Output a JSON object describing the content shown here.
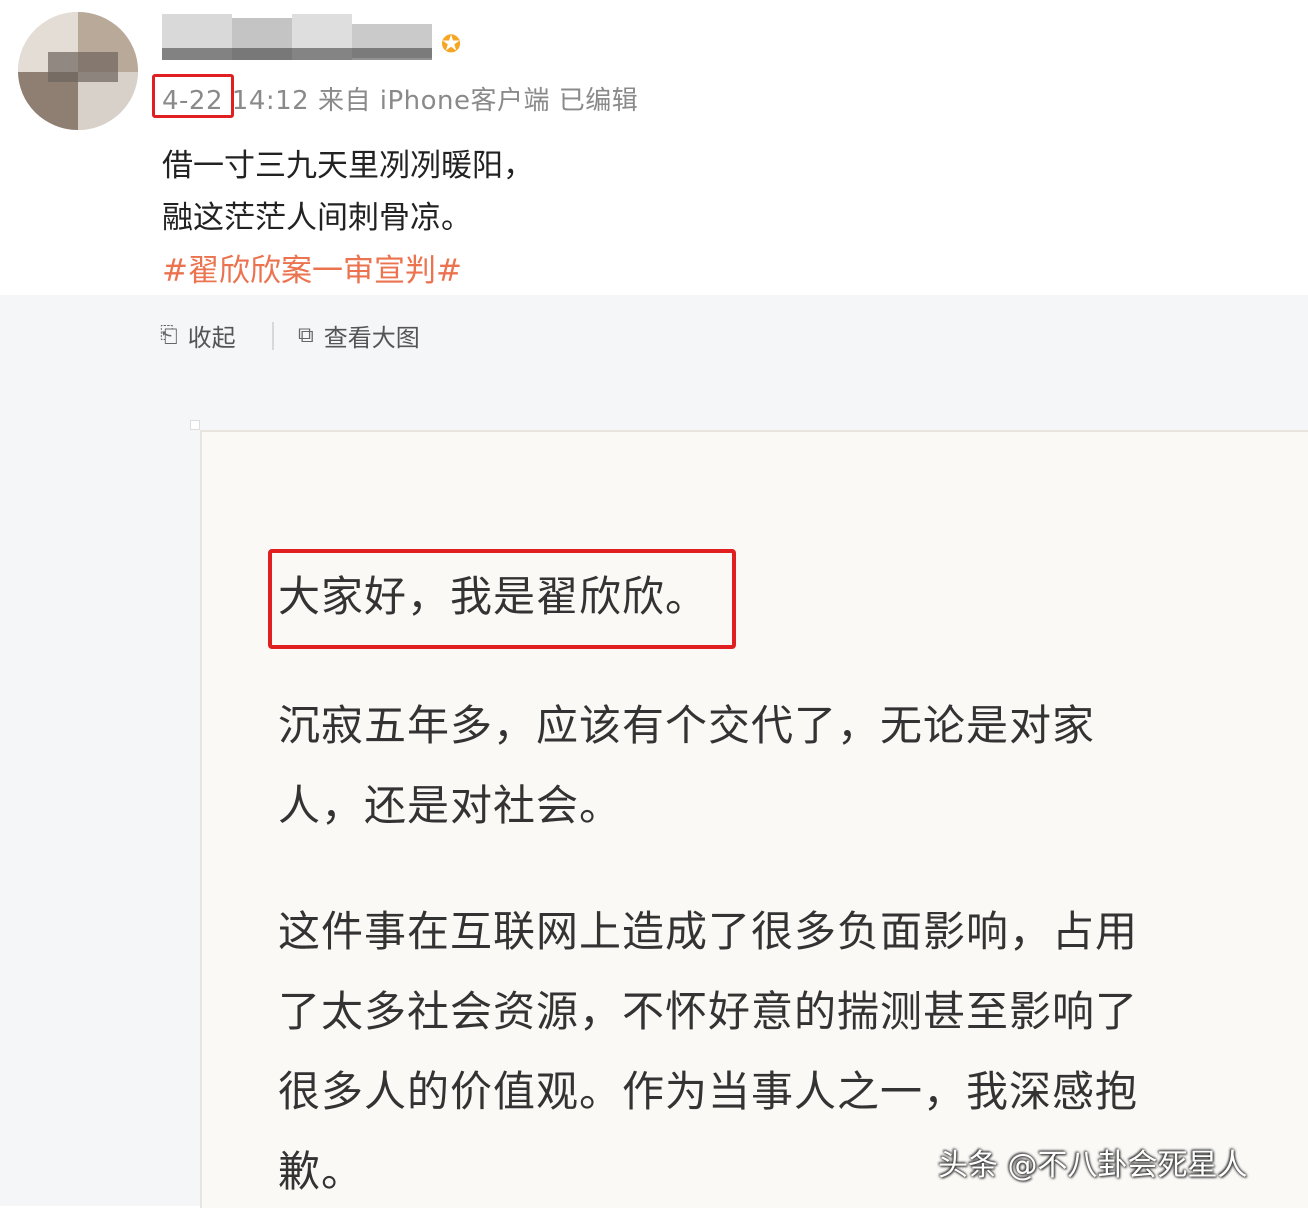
{
  "post": {
    "date": "4-22",
    "meta_rest": "14:12 来自 iPhone客户端 已编辑",
    "lines": [
      "借一寸三九天里冽冽暖阳，",
      "融这茫茫人间刺骨凉。"
    ],
    "topic": "#翟欣欣案一审宣判#"
  },
  "actions": {
    "collapse_label": "收起",
    "view_large_label": "查看大图"
  },
  "letter": {
    "greeting": "大家好，我是翟欣欣。",
    "lines": [
      "沉寂五年多，应该有个交代了，无论是对家",
      "人，还是对社会。",
      "这件事在互联网上造成了很多负面影响，占用",
      "了太多社会资源，不怀好意的揣测甚至影响了",
      "很多人的价值观。作为当事人之一，我深感抱",
      "歉。"
    ]
  },
  "watermark": "头条 @不八卦会死星人",
  "colors": {
    "highlight_box": "#e02020",
    "topic": "#eb7350"
  },
  "icons": {
    "verified": "verified-badge-icon",
    "collapse": "collapse-icon",
    "view_large": "zoom-image-icon"
  }
}
